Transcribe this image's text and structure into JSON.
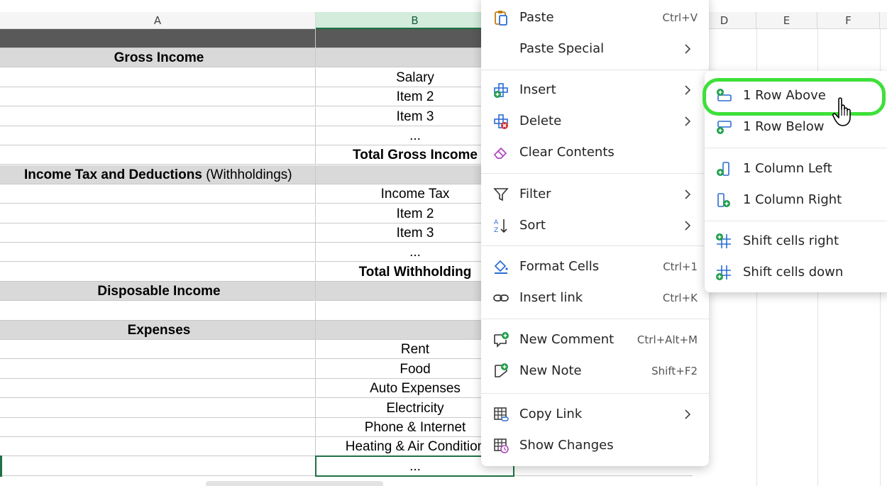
{
  "columns": [
    "A",
    "B",
    "",
    "D",
    "E",
    "F"
  ],
  "selected_column": "B",
  "rows": [
    {
      "a": "",
      "b": "",
      "style": "dark"
    },
    {
      "a": "Gross Income",
      "b": "",
      "style": "gray-center-bold"
    },
    {
      "a": "",
      "b": "Salary",
      "style": "plain"
    },
    {
      "a": "",
      "b": "Item 2",
      "style": "plain"
    },
    {
      "a": "",
      "b": "Item 3",
      "style": "plain"
    },
    {
      "a": "",
      "b": "...",
      "style": "plain"
    },
    {
      "a": "",
      "b": "Total Gross Income",
      "style": "plain-boldb"
    },
    {
      "a": "Income Tax and Deductions",
      "a_suffix": " (Withholdings)",
      "b": "",
      "style": "gray-left-bold"
    },
    {
      "a": "",
      "b": "Income Tax",
      "style": "plain"
    },
    {
      "a": "",
      "b": "Item 2",
      "style": "plain"
    },
    {
      "a": "",
      "b": "Item 3",
      "style": "plain"
    },
    {
      "a": "",
      "b": "...",
      "style": "plain"
    },
    {
      "a": "",
      "b": "Total Withholding",
      "style": "plain-boldb"
    },
    {
      "a": "Disposable Income",
      "b": "",
      "style": "gray-center-bold"
    },
    {
      "a": "",
      "b": "",
      "style": "plain"
    },
    {
      "a": "Expenses",
      "b": "",
      "style": "gray-center-bold"
    },
    {
      "a": "",
      "b": "Rent",
      "style": "plain"
    },
    {
      "a": "",
      "b": "Food",
      "style": "plain"
    },
    {
      "a": "",
      "b": "Auto Expenses",
      "style": "plain"
    },
    {
      "a": "",
      "b": "Electricity",
      "style": "plain"
    },
    {
      "a": "",
      "b": "Phone & Internet",
      "style": "plain"
    },
    {
      "a": "",
      "b": "Heating & Air Condition",
      "style": "plain"
    },
    {
      "a": "",
      "b": "...",
      "style": "plain"
    }
  ],
  "context_menu": {
    "items": [
      {
        "label": "Paste",
        "shortcut": "Ctrl+V",
        "icon": "paste-icon"
      },
      {
        "label": "Paste Special",
        "submenu": true,
        "icon": ""
      },
      {
        "label": "Insert",
        "submenu": true,
        "icon": "insert-icon"
      },
      {
        "label": "Delete",
        "submenu": true,
        "icon": "delete-icon"
      },
      {
        "label": "Clear Contents",
        "icon": "eraser-icon"
      },
      {
        "label": "Filter",
        "submenu": true,
        "icon": "filter-icon"
      },
      {
        "label": "Sort",
        "submenu": true,
        "icon": "sort-icon"
      },
      {
        "label": "Format Cells",
        "shortcut": "Ctrl+1",
        "icon": "format-cells-icon"
      },
      {
        "label": "Insert link",
        "shortcut": "Ctrl+K",
        "icon": "link-icon"
      },
      {
        "label": "New Comment",
        "shortcut": "Ctrl+Alt+M",
        "icon": "new-comment-icon"
      },
      {
        "label": "New Note",
        "shortcut": "Shift+F2",
        "icon": "new-note-icon"
      },
      {
        "label": "Copy Link",
        "submenu": true,
        "icon": "copy-link-icon"
      },
      {
        "label": "Show Changes",
        "icon": "show-changes-icon"
      }
    ]
  },
  "insert_submenu": {
    "items": [
      {
        "label": "1 Row Above",
        "icon": "row-above-icon",
        "highlighted": true
      },
      {
        "label": "1 Row Below",
        "icon": "row-below-icon"
      },
      {
        "label": "1 Column Left",
        "icon": "column-left-icon"
      },
      {
        "label": "1 Column Right",
        "icon": "column-right-icon"
      },
      {
        "label": "Shift cells right",
        "icon": "shift-right-icon"
      },
      {
        "label": "Shift cells down",
        "icon": "shift-down-icon"
      }
    ]
  },
  "colors": {
    "accent": "#1e7145",
    "highlight_ring": "#3ee03a",
    "icon_blue": "#2b6cd4",
    "icon_green": "#1e9e4a",
    "icon_red": "#d13438"
  }
}
